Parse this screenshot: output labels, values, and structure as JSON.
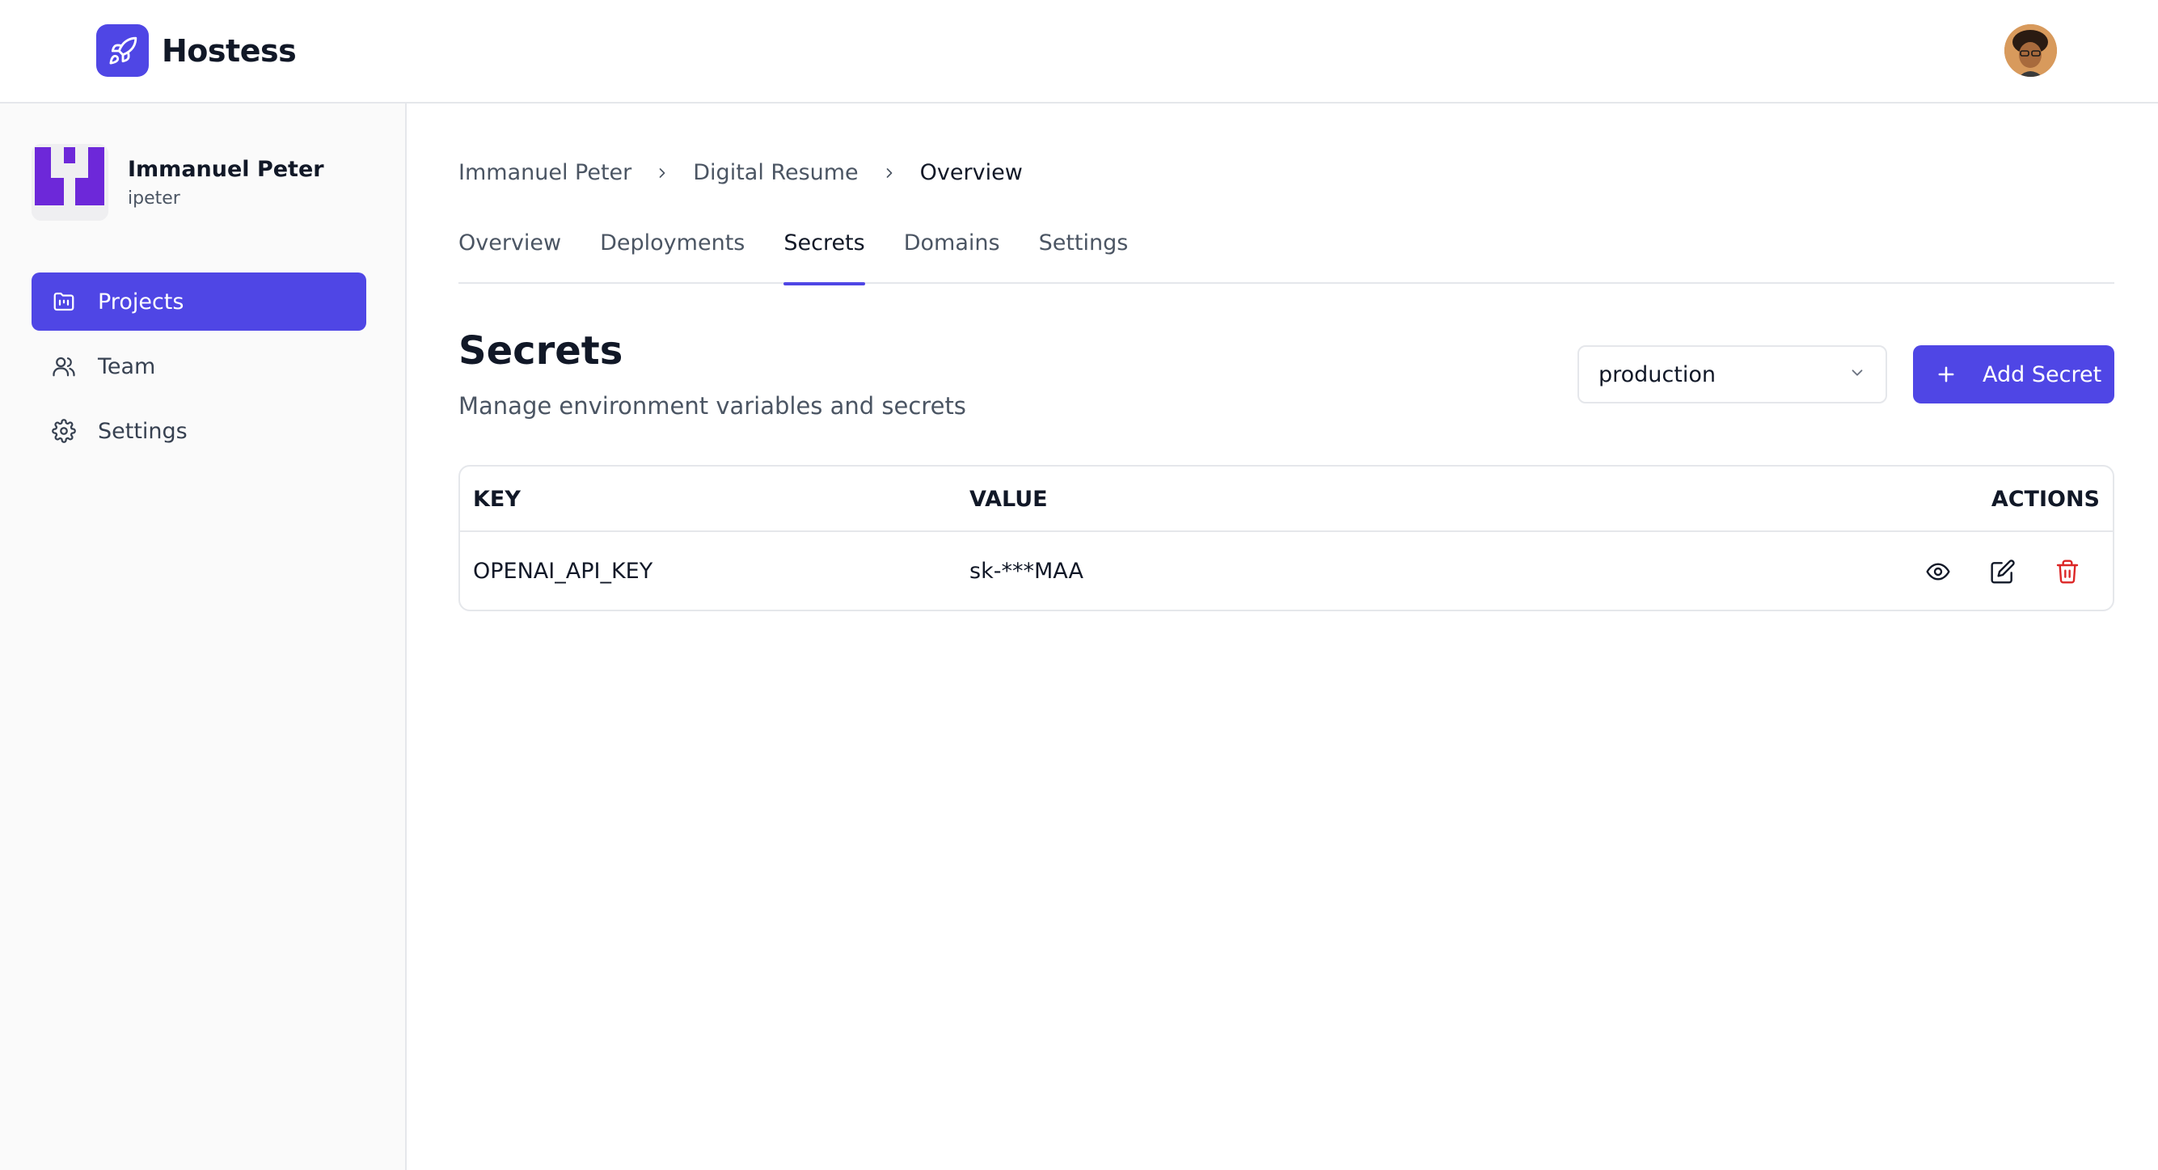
{
  "app": {
    "name": "Hostess"
  },
  "user": {
    "name": "Immanuel Peter",
    "handle": "ipeter"
  },
  "sidebar": {
    "items": [
      {
        "label": "Projects",
        "icon": "folder-icon",
        "active": true
      },
      {
        "label": "Team",
        "icon": "users-icon",
        "active": false
      },
      {
        "label": "Settings",
        "icon": "gear-icon",
        "active": false
      }
    ]
  },
  "breadcrumb": {
    "items": [
      "Immanuel Peter",
      "Digital Resume",
      "Overview"
    ]
  },
  "tabs": [
    {
      "label": "Overview",
      "active": false
    },
    {
      "label": "Deployments",
      "active": false
    },
    {
      "label": "Secrets",
      "active": true
    },
    {
      "label": "Domains",
      "active": false
    },
    {
      "label": "Settings",
      "active": false
    }
  ],
  "secrets": {
    "title": "Secrets",
    "subtitle": "Manage environment variables and secrets",
    "environment": "production",
    "add_label": "Add Secret",
    "columns": {
      "key": "KEY",
      "value": "VALUE",
      "actions": "ACTIONS"
    },
    "rows": [
      {
        "key": "OPENAI_API_KEY",
        "value": "sk-***MAA"
      }
    ]
  },
  "colors": {
    "accent": "#4f46e5",
    "danger": "#dc2626",
    "border": "#e5e7eb",
    "muted_text": "#4b5563"
  }
}
